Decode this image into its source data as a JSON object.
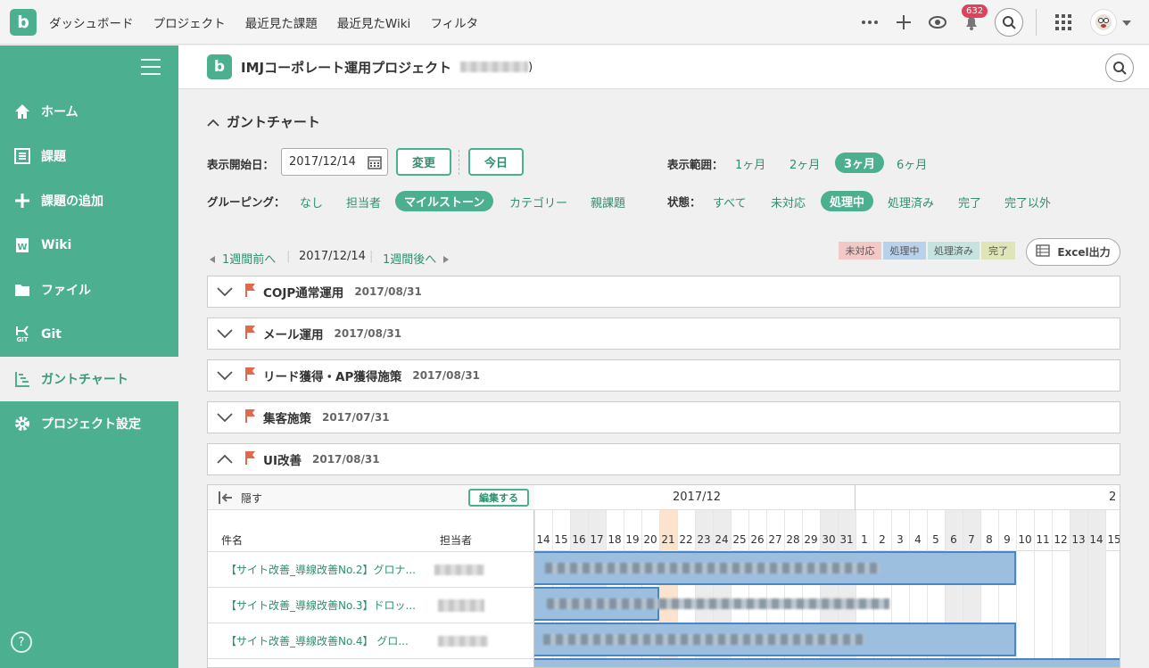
{
  "topbar": {
    "logo": "b",
    "nav": [
      "ダッシュボード",
      "プロジェクト",
      "最近見た課題",
      "最近見たWiki",
      "フィルタ"
    ],
    "notification_count": "632"
  },
  "sidebar": {
    "items": [
      {
        "label": "ホーム",
        "icon": "home-icon"
      },
      {
        "label": "課題",
        "icon": "list-icon"
      },
      {
        "label": "課題の追加",
        "icon": "plus-icon"
      },
      {
        "label": "Wiki",
        "icon": "wiki-icon"
      },
      {
        "label": "ファイル",
        "icon": "folder-icon"
      },
      {
        "label": "Git",
        "icon": "git-icon"
      },
      {
        "label": "ガントチャート",
        "icon": "gantt-icon"
      },
      {
        "label": "プロジェクト設定",
        "icon": "gear-icon"
      }
    ],
    "active_index": 6,
    "help": "?",
    "git_sub": "GIT"
  },
  "project": {
    "title": "IMJコーポレート運用プロジェクト",
    "suffix": ")"
  },
  "gantt": {
    "heading": "ガントチャート",
    "start_label": "表示開始日：",
    "start_date": "2017/12/14",
    "change_button": "変更",
    "today_button": "今日",
    "range_label": "表示範囲：",
    "ranges": [
      "1ヶ月",
      "2ヶ月",
      "3ヶ月",
      "6ヶ月"
    ],
    "range_selected": "3ヶ月",
    "grouping_label": "グルーピング：",
    "groupings": [
      "なし",
      "担当者",
      "マイルストーン",
      "カテゴリー",
      "親課題"
    ],
    "grouping_selected": "マイルストーン",
    "status_label": "状態：",
    "statuses": [
      "すべて",
      "未対応",
      "処理中",
      "処理済み",
      "完了",
      "完了以外"
    ],
    "status_selected": "処理中",
    "prev_week": "1週間前へ",
    "current": "2017/12/14",
    "next_week": "1週間後へ",
    "legend": [
      {
        "label": "未対応",
        "color": "#f2c9c6"
      },
      {
        "label": "処理中",
        "color": "#b9d2ea"
      },
      {
        "label": "処理済み",
        "color": "#c7e3df"
      },
      {
        "label": "完了",
        "color": "#dfe5b8"
      }
    ],
    "excel_button": "Excel出力",
    "milestones": [
      {
        "name": "COJP通常運用",
        "date": "2017/08/31",
        "collapsed": true
      },
      {
        "name": "メール運用",
        "date": "2017/08/31",
        "collapsed": true
      },
      {
        "name": "リード獲得・AP獲得施策",
        "date": "2017/08/31",
        "collapsed": true
      },
      {
        "name": "集客施策",
        "date": "2017/07/31",
        "collapsed": true
      },
      {
        "name": "UI改善",
        "date": "2017/08/31",
        "collapsed": false
      }
    ],
    "hide_label": "隠す",
    "edit_button": "編集する",
    "col_issue": "件名",
    "col_assignee": "担当者",
    "month_label": "2017/12",
    "next_month_label": "2",
    "days": [
      "14",
      "15",
      "16",
      "17",
      "18",
      "19",
      "20",
      "21",
      "22",
      "23",
      "24",
      "25",
      "26",
      "27",
      "28",
      "29",
      "30",
      "31",
      "1",
      "2",
      "3",
      "4",
      "5",
      "6",
      "7",
      "8",
      "9",
      "10",
      "11",
      "12",
      "13",
      "14",
      "15"
    ],
    "issues": [
      "【サイト改善_導線改善No.2】グロナ...",
      "【サイト改善_導線改善No.3】ドロッ...",
      "【サイト改善_導線改善No.4】 グロ..."
    ]
  }
}
